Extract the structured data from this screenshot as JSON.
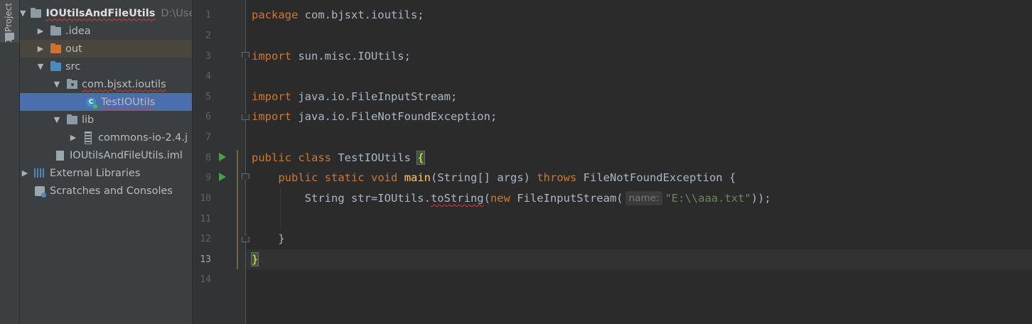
{
  "toolwindow": {
    "label": "1: Project"
  },
  "tree": {
    "root_name": "IOUtilsAndFileUtils",
    "root_path": "D:\\Use",
    "items": [
      {
        "label": ".idea"
      },
      {
        "label": "out"
      },
      {
        "label": "src"
      },
      {
        "label": "com.bjsxt.ioutils"
      },
      {
        "label": "TestIOUtils"
      },
      {
        "label": "lib"
      },
      {
        "label": "commons-io-2.4.j"
      },
      {
        "label": "IOUtilsAndFileUtils.iml"
      },
      {
        "label": "External Libraries"
      },
      {
        "label": "Scratches and Consoles"
      }
    ]
  },
  "editor": {
    "line_numbers": [
      "1",
      "2",
      "3",
      "4",
      "5",
      "6",
      "7",
      "8",
      "9",
      "10",
      "11",
      "12",
      "13",
      "14"
    ],
    "current_line": "13",
    "lines": {
      "l1_kw": "package",
      "l1_rest": " com.bjsxt.ioutils;",
      "l3_kw": "import",
      "l3_rest": " sun.misc.IOUtils;",
      "l5_kw": "import",
      "l5_rest": " java.io.FileInputStream;",
      "l6_kw": "import",
      "l6_rest": " java.io.FileNotFoundException;",
      "l8_kw1": "public",
      "l8_kw2": "class",
      "l8_name": " TestIOUtils ",
      "l8_brace": "{",
      "l9_indent": "    ",
      "l9_kw1": "public",
      "l9_kw2": "static",
      "l9_kw3": "void",
      "l9_fn": "main",
      "l9_params": "(String[] args) ",
      "l9_kw4": "throws",
      "l9_rest": " FileNotFoundException {",
      "l10_indent": "        ",
      "l10_a": "String str=IOUtils.",
      "l10_method": "toString",
      "l10_b": "(",
      "l10_kw": "new",
      "l10_c": " FileInputStream(",
      "l10_hint": "name:",
      "l10_str": "\"E:\\\\aaa.txt\"",
      "l10_end": "));",
      "l12_text": "    }",
      "l13_text": "}"
    }
  },
  "colors": {
    "background": "#2b2b2b",
    "keyword": "#cc7832",
    "string": "#6a8759",
    "method": "#ffc66d",
    "selection": "#4b6eaf"
  }
}
